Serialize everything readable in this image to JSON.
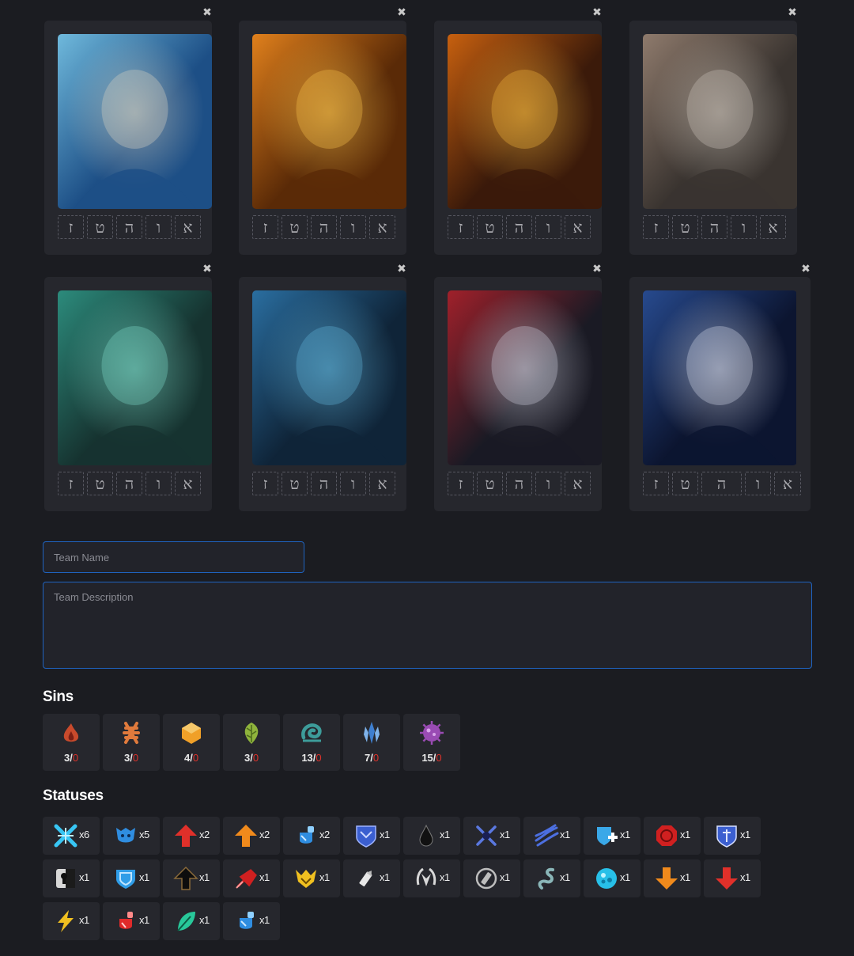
{
  "cards": [
    {
      "name": "card-1",
      "slots": [
        "ז",
        "ט",
        "ה",
        "ו",
        "א"
      ],
      "colors": [
        "#1d4f86",
        "#6fb9dc",
        "#d7d2c0"
      ]
    },
    {
      "name": "card-2",
      "slots": [
        "ז",
        "ט",
        "ה",
        "ו",
        "א"
      ],
      "colors": [
        "#5a2a07",
        "#e0801c",
        "#f6c14a"
      ]
    },
    {
      "name": "card-3",
      "slots": [
        "ז",
        "ט",
        "ה",
        "ו",
        "א"
      ],
      "colors": [
        "#3b1a0a",
        "#c7600f",
        "#f1b43b"
      ]
    },
    {
      "name": "card-4",
      "slots": [
        "ז",
        "ט",
        "ה",
        "ו",
        "א"
      ],
      "colors": [
        "#3a3430",
        "#8e7a6c",
        "#c9c1b6"
      ]
    },
    {
      "name": "card-5",
      "slots": [
        "ז",
        "ט",
        "ה",
        "ו",
        "א"
      ],
      "colors": [
        "#163330",
        "#2c8b7c",
        "#7bd8c6"
      ]
    },
    {
      "name": "card-6",
      "slots": [
        "ז",
        "ט",
        "ה",
        "ו",
        "א"
      ],
      "colors": [
        "#0f2438",
        "#2a6ea0",
        "#5fb1d8"
      ]
    },
    {
      "name": "card-7",
      "slots": [
        "ז",
        "ט",
        "ה",
        "ו",
        "א"
      ],
      "colors": [
        "#1a1a24",
        "#a0202a",
        "#c9c9d6"
      ]
    },
    {
      "name": "card-8",
      "slots": [
        "ז",
        "ט",
        "ה",
        "ו",
        "א"
      ],
      "colors": [
        "#0c1530",
        "#274a8e",
        "#cfd4e4"
      ]
    }
  ],
  "form": {
    "team_name_placeholder": "Team Name",
    "team_description_placeholder": "Team Description"
  },
  "sins_heading": "Sins",
  "sins": [
    {
      "icon": "wrath-icon",
      "color": "#c84a2c",
      "have": "3",
      "need": "0"
    },
    {
      "icon": "lust-icon",
      "color": "#e07a3c",
      "have": "3",
      "need": "0"
    },
    {
      "icon": "sloth-icon",
      "color": "#f0a028",
      "have": "4",
      "need": "0"
    },
    {
      "icon": "gluttony-icon",
      "color": "#8fb43c",
      "have": "3",
      "need": "0"
    },
    {
      "icon": "gloom-icon",
      "color": "#3d9c9a",
      "have": "13",
      "need": "0"
    },
    {
      "icon": "pride-icon",
      "color": "#3e7fd0",
      "have": "7",
      "need": "0"
    },
    {
      "icon": "envy-icon",
      "color": "#9a4bb4",
      "have": "15",
      "need": "0"
    }
  ],
  "statuses_heading": "Statuses",
  "statuses": [
    {
      "icon": "rupture-icon",
      "color": "#38c6f4",
      "count": "x6"
    },
    {
      "icon": "charge-icon",
      "color": "#2f8de0",
      "count": "x5"
    },
    {
      "icon": "power-up-icon",
      "color": "#e0302a",
      "count": "x2"
    },
    {
      "icon": "haste-icon",
      "color": "#f08a1c",
      "count": "x2"
    },
    {
      "icon": "blue-shield-potion-icon",
      "color": "#2f8de0",
      "count": "x2"
    },
    {
      "icon": "blue-emblem-icon",
      "color": "#3b5fd0",
      "count": "x1"
    },
    {
      "icon": "ink-drop-icon",
      "color": "#111111",
      "count": "x1"
    },
    {
      "icon": "cross-slash-icon",
      "color": "#5a78e0",
      "count": "x1"
    },
    {
      "icon": "blue-claw-icon",
      "color": "#4c6fe0",
      "count": "x1"
    },
    {
      "icon": "shield-plus-icon",
      "color": "#3aa8e8",
      "count": "x1"
    },
    {
      "icon": "red-seal-icon",
      "color": "#d02020",
      "count": "x1"
    },
    {
      "icon": "blue-badge-icon",
      "color": "#3b5fd0",
      "count": "x1"
    },
    {
      "icon": "keyhole-icon",
      "color": "#d8d8d8",
      "count": "x1"
    },
    {
      "icon": "protection-icon",
      "color": "#2f9de8",
      "count": "x1"
    },
    {
      "icon": "black-arrow-up-icon",
      "color": "#0d0d0d",
      "count": "x1"
    },
    {
      "icon": "red-fist-icon",
      "color": "#d02020",
      "count": "x1"
    },
    {
      "icon": "gold-crest-icon",
      "color": "#f0c020",
      "count": "x1"
    },
    {
      "icon": "bullet-icon",
      "color": "#e8e8e8",
      "count": "x1"
    },
    {
      "icon": "laurel-icon",
      "color": "#d8d8d8",
      "count": "x1"
    },
    {
      "icon": "no-bullet-icon",
      "color": "#bdbdbd",
      "count": "x1"
    },
    {
      "icon": "smoke-icon",
      "color": "#8ab6b8",
      "count": "x1"
    },
    {
      "icon": "blue-orb-icon",
      "color": "#28c0e8",
      "count": "x1"
    },
    {
      "icon": "orange-arrow-down-icon",
      "color": "#f08a1c",
      "count": "x1"
    },
    {
      "icon": "red-arrow-down-icon",
      "color": "#e0302a",
      "count": "x1"
    },
    {
      "icon": "lightning-icon",
      "color": "#f0c020",
      "count": "x1"
    },
    {
      "icon": "red-potion-icon",
      "color": "#e02a2a",
      "count": "x1"
    },
    {
      "icon": "green-leaf-icon",
      "color": "#28c89a",
      "count": "x1"
    },
    {
      "icon": "blue-potion-icon",
      "color": "#2f8de0",
      "count": "x1"
    }
  ]
}
